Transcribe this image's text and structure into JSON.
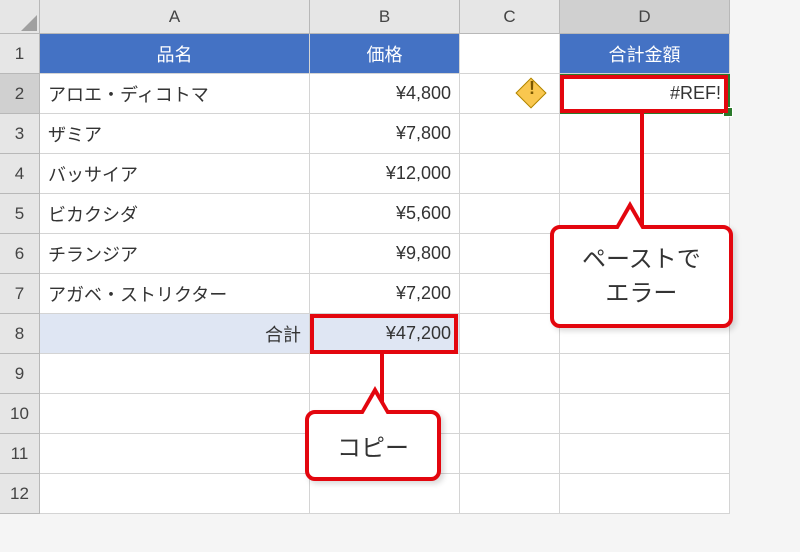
{
  "columns": [
    "A",
    "B",
    "C",
    "D"
  ],
  "rows_shown": [
    1,
    2,
    3,
    4,
    5,
    6,
    7,
    8,
    9,
    10,
    11,
    12
  ],
  "headers": {
    "A": "品名",
    "B": "価格",
    "D": "合計金額"
  },
  "data": {
    "products": [
      {
        "name": "アロエ・ディコトマ",
        "price": "¥4,800"
      },
      {
        "name": "ザミア",
        "price": "¥7,800"
      },
      {
        "name": "バッサイア",
        "price": "¥12,000"
      },
      {
        "name": "ビカクシダ",
        "price": "¥5,600"
      },
      {
        "name": "チランジア",
        "price": "¥9,800"
      },
      {
        "name": "アガベ・ストリクター",
        "price": "¥7,200"
      }
    ],
    "total_label": "合計",
    "total_value": "¥47,200",
    "d2_value": "#REF!"
  },
  "callouts": {
    "copy": "コピー",
    "paste": "ペーストで\nエラー"
  }
}
